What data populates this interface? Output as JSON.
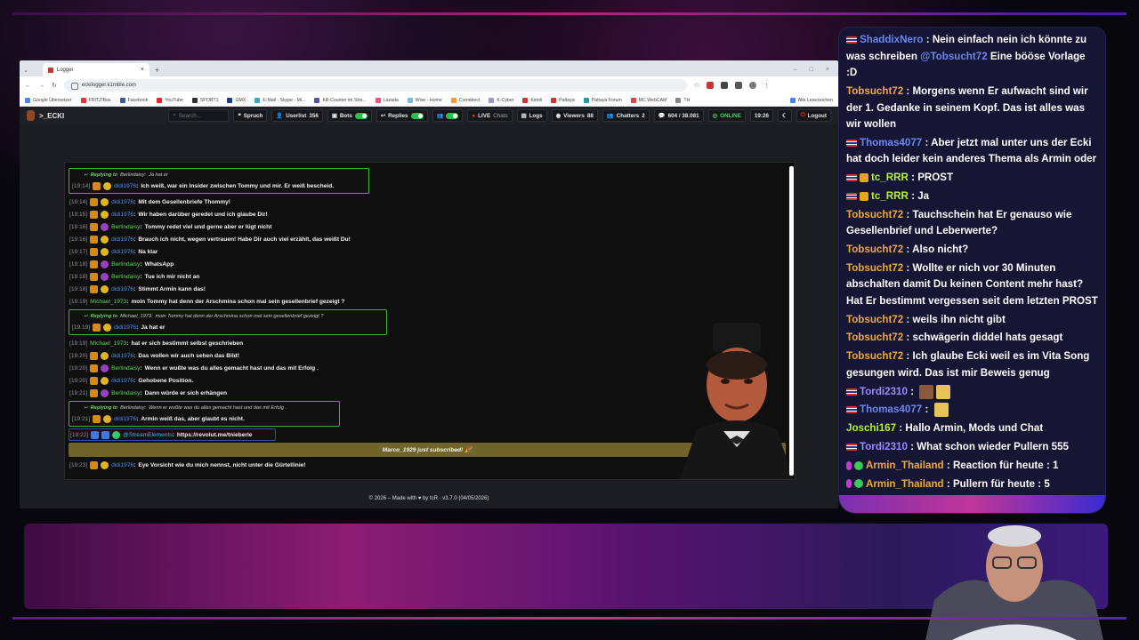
{
  "browser": {
    "tab_title": "Logger",
    "url": "eckilogger.k1mble.com",
    "bookmarks": [
      "Google Übersetzer",
      "FRITZ!Box",
      "Facebook",
      "YouTube",
      "SPORT1",
      "GMX",
      "E-Mail - Skype - Mi...",
      "Kill-Counter im Stre...",
      "Lazada",
      "Wise - Home",
      "Comdirect",
      "K-Cyber",
      "Kimiti",
      "Pattaya",
      "Pattaya Forum",
      "MC WebCAM",
      "TH",
      "Alle Lesezeichen"
    ]
  },
  "app": {
    "brand": ">_ECKI",
    "search_placeholder": "Search...",
    "nav": {
      "spruch": "Spruch",
      "userlist": "Userlist",
      "userlist_count": "356",
      "bots": "Bots",
      "replies": "Replies",
      "live": "LIVE",
      "chats": "Chats",
      "logs": "Logs",
      "viewers": "Viewers",
      "viewers_count": "88",
      "chatters": "Chatters",
      "chatters_count": "2",
      "messages": "604 / 38.081",
      "status": "ONLINE",
      "time": "19:26",
      "logout": "Logout"
    },
    "footer": "© 2026 – Made with ♥ by tcR · v3.7.0 (04/05/2026)"
  },
  "chat": {
    "reply1": {
      "head_prefix": "Replying to",
      "head_user": "Berlindaisy:",
      "head_text": "Ja hat er",
      "ts": "[19:14]",
      "user": "didi1976",
      "text": "Ich weiß, war ein Insider zwischen Tommy und mir. Er weiß bescheid."
    },
    "lines_a": [
      {
        "ts": "[19:14]",
        "user": "didi1976",
        "color": "blue",
        "badge": "yellow",
        "text": "Mit dem Gesellenbriefe Thommy!"
      },
      {
        "ts": "[19:15]",
        "user": "didi1976",
        "color": "blue",
        "badge": "yellow",
        "text": "Wir haben darüber geredet und ich glaube Dir!"
      },
      {
        "ts": "[19:16]",
        "user": "Berlindaisy",
        "color": "green",
        "badge": "purple",
        "text": "Tommy redet viel und gerne aber er lügt nicht"
      },
      {
        "ts": "[19:16]",
        "user": "didi1976",
        "color": "blue",
        "badge": "yellow",
        "text": "Brauch ich nicht, wegen vertrauen! Habe Dir auch viel erzählt, das weißt Du!"
      },
      {
        "ts": "[19:17]",
        "user": "didi1976",
        "color": "blue",
        "badge": "yellow",
        "text": "Na klar"
      },
      {
        "ts": "[19:18]",
        "user": "Berlindaisy",
        "color": "green",
        "badge": "purple",
        "text": "WhatsApp"
      },
      {
        "ts": "[19:18]",
        "user": "Berlindaisy",
        "color": "green",
        "badge": "purple",
        "text": "Tue ich mir nicht an"
      },
      {
        "ts": "[19:18]",
        "user": "didi1976",
        "color": "blue",
        "badge": "yellow",
        "text": "Stimmt Armin kann das!"
      },
      {
        "ts": "[19:19]",
        "user": "Michael_1973",
        "color": "green",
        "badge": "",
        "text": "moin Tommy hat denn der Arschmina schon mal sein gesellenbrief gezeigt ?"
      }
    ],
    "reply2": {
      "head_prefix": "Replying to",
      "head_user": "Michael_1973:",
      "head_text": "moin Tommy hat denn der Arschmina schon mal sein gesellenbrief gezeigt ?",
      "ts": "[19:19]",
      "user": "didi1976",
      "text": "Ja hat er"
    },
    "lines_b": [
      {
        "ts": "[19:19]",
        "user": "Michael_1973",
        "color": "green",
        "badge": "",
        "text": "hat er sich bestimmt selbst geschrieben"
      },
      {
        "ts": "[19:20]",
        "user": "didi1976",
        "color": "blue",
        "badge": "yellow",
        "text": "Das wollen wir auch sehen das Bild!"
      },
      {
        "ts": "[19:20]",
        "user": "Berlindaisy",
        "color": "green",
        "badge": "purple",
        "text": "Wenn er wußte was du alles gemacht hast und das mit Erfolg ."
      },
      {
        "ts": "[19:20]",
        "user": "didi1976",
        "color": "blue",
        "badge": "yellow",
        "text": "Gehobene Position."
      },
      {
        "ts": "[19:21]",
        "user": "Berlindaisy",
        "color": "green",
        "badge": "purple",
        "text": "Dann würde er sich erhängen"
      }
    ],
    "reply3": {
      "head_prefix": "Replying to",
      "head_user": "Berlindaisy:",
      "head_text": "Wenn er wußte was du alles gemacht hast und das mit Erfolg .",
      "ts": "[19:21]",
      "user": "didi1976",
      "text": "Armin weiß das, aber glaubt es nicht."
    },
    "link_line": {
      "ts": "[19:22]",
      "user": "@StreamElements",
      "text": "https://revolut.me/tnieberle"
    },
    "sub_banner": "Marco_1929 just subscribed! 🎉",
    "last_line": {
      "ts": "[19:23]",
      "user": "didi1976",
      "text": "Eye Vorsicht wie du mich nennst, nicht unter die Gürtellinie!"
    }
  },
  "overlay_chat": [
    {
      "badges": [
        "flag"
      ],
      "user": "ShaddixNero",
      "color": "blue",
      "text": "Nein einfach nein ich könnte zu was schreiben ",
      "mention": "@Tobsucht72",
      "text2": " Eine bööse Vorlage :D"
    },
    {
      "badges": [],
      "user": "Tobsucht72",
      "color": "orange",
      "text": "Morgens wenn Er aufwacht sind wir der 1. Gedanke in seinem Kopf. Das ist alles was wir wollen"
    },
    {
      "badges": [
        "flag"
      ],
      "user": "Thomas4077",
      "color": "blue",
      "text": "Aber jetzt mal unter uns der Ecki hat doch leider kein anderes Thema als Armin oder"
    },
    {
      "badges": [
        "flag",
        "crown"
      ],
      "user": "tc_RRR",
      "color": "lgreen",
      "text": "PROST"
    },
    {
      "badges": [
        "flag",
        "crown"
      ],
      "user": "tc_RRR",
      "color": "lgreen",
      "text": "Ja"
    },
    {
      "badges": [],
      "user": "Tobsucht72",
      "color": "orange",
      "text": "Tauchschein hat Er genauso wie Gesellenbrief und Leberwerte?"
    },
    {
      "badges": [],
      "user": "Tobsucht72",
      "color": "orange",
      "text": "Also nicht?"
    },
    {
      "badges": [],
      "user": "Tobsucht72",
      "color": "orange",
      "text": "Wollte er nich vor 30 Minuten abschalten damit Du keinen Content mehr hast? Hat Er bestimmt vergessen seit dem letzten PROST"
    },
    {
      "badges": [],
      "user": "Tobsucht72",
      "color": "orange",
      "text": "weils ihn nicht gibt"
    },
    {
      "badges": [],
      "user": "Tobsucht72",
      "color": "orange",
      "text": "schwägerin diddel hats gesagt"
    },
    {
      "badges": [],
      "user": "Tobsucht72",
      "color": "orange",
      "text": "Ich glaube Ecki weil es im Vita Song gesungen wird. Das ist mir Beweis genug"
    },
    {
      "badges": [
        "flag"
      ],
      "user": "Tordi2310",
      "color": "violet",
      "text": "",
      "emotes": 2
    },
    {
      "badges": [
        "flag"
      ],
      "user": "Thomas4077",
      "color": "blue",
      "text": "",
      "emotes": 1
    },
    {
      "badges": [],
      "user": "Joschi167",
      "color": "lgreen",
      "text": "Hallo Armin, Mods und Chat"
    },
    {
      "badges": [
        "flag"
      ],
      "user": "Tordi2310",
      "color": "violet",
      "text": "What schon wieder Pullern 555"
    },
    {
      "badges": [
        "mic",
        "check"
      ],
      "user": "Armin_Thailand",
      "color": "orange",
      "text": "Reaction für heute : 1"
    },
    {
      "badges": [
        "mic",
        "check"
      ],
      "user": "Armin_Thailand",
      "color": "orange",
      "text": "Pullern für heute : 5"
    }
  ],
  "colors": {
    "accent_green": "#2dbf4e",
    "reply_border": "#3ab53a",
    "overlay_bg": "#161636",
    "sub_banner": "#706428"
  }
}
